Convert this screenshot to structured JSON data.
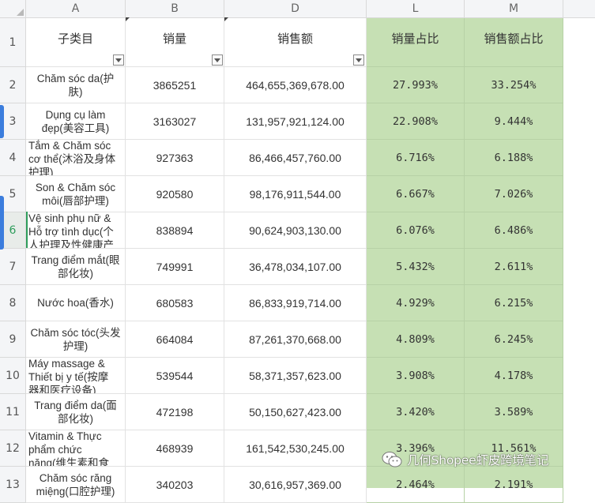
{
  "columns": [
    "A",
    "B",
    "D",
    "L",
    "M"
  ],
  "header_row": {
    "row_num": "1",
    "subcategory": "子类目",
    "sales_volume": "销量",
    "sales_amount": "销售额",
    "volume_share": "销量占比",
    "amount_share": "销售额占比"
  },
  "rows": [
    {
      "row_num": "2",
      "name": [
        "Chăm sóc da(护",
        "肤)"
      ],
      "volume": "3865251",
      "amount": "464,655,369,678.00",
      "volume_pct": "27.993%",
      "amount_pct": "33.254%"
    },
    {
      "row_num": "3",
      "name": [
        "Dụng cụ làm",
        "đẹp(美容工具)"
      ],
      "volume": "3163027",
      "amount": "131,957,921,124.00",
      "volume_pct": "22.908%",
      "amount_pct": "9.444%"
    },
    {
      "row_num": "4",
      "name": [
        "Tắm & Chăm sóc",
        "cơ thể(沐浴及身体",
        "护理)"
      ],
      "volume": "927363",
      "amount": "86,466,457,760.00",
      "volume_pct": "6.716%",
      "amount_pct": "6.188%"
    },
    {
      "row_num": "5",
      "name": [
        "Son & Chăm sóc",
        "môi(唇部护理)"
      ],
      "volume": "920580",
      "amount": "98,176,911,544.00",
      "volume_pct": "6.667%",
      "amount_pct": "7.026%"
    },
    {
      "row_num": "6",
      "name": [
        "Vệ sinh phụ nữ &",
        "Hỗ trợ tình dục(个",
        "人护理及性健康产"
      ],
      "volume": "838894",
      "amount": "90,624,903,130.00",
      "volume_pct": "6.076%",
      "amount_pct": "6.486%"
    },
    {
      "row_num": "7",
      "name": [
        "Trang điểm mắt(眼",
        "部化妆)"
      ],
      "volume": "749991",
      "amount": "36,478,034,107.00",
      "volume_pct": "5.432%",
      "amount_pct": "2.611%"
    },
    {
      "row_num": "8",
      "name": [
        "Nước hoa(香水)"
      ],
      "volume": "680583",
      "amount": "86,833,919,714.00",
      "volume_pct": "4.929%",
      "amount_pct": "6.215%"
    },
    {
      "row_num": "9",
      "name": [
        "Chăm sóc tóc(头发",
        "护理)"
      ],
      "volume": "664084",
      "amount": "87,261,370,668.00",
      "volume_pct": "4.809%",
      "amount_pct": "6.245%"
    },
    {
      "row_num": "10",
      "name": [
        "Máy massage &",
        "Thiết bị y tế(按摩",
        "器和医疗设备)"
      ],
      "volume": "539544",
      "amount": "58,371,357,623.00",
      "volume_pct": "3.908%",
      "amount_pct": "4.178%"
    },
    {
      "row_num": "11",
      "name": [
        "Trang điểm da(面",
        "部化妆)"
      ],
      "volume": "472198",
      "amount": "50,150,627,423.00",
      "volume_pct": "3.420%",
      "amount_pct": "3.589%"
    },
    {
      "row_num": "12",
      "name": [
        "Vitamin & Thực",
        "phẩm chức",
        "năng(维生素和食"
      ],
      "volume": "468939",
      "amount": "161,542,530,245.00",
      "volume_pct": "3.396%",
      "amount_pct": "11.561%"
    },
    {
      "row_num": "13",
      "name": [
        "Chăm sóc răng",
        "miệng(口腔护理)"
      ],
      "volume": "340203",
      "amount": "30,616,957,369.00",
      "volume_pct": "2.464%",
      "amount_pct": "2.191%"
    }
  ],
  "watermark": {
    "text": "几何Shopee虾皮跨境笔记",
    "icon": "wechat-icon"
  },
  "colors": {
    "highlight_fill": "#c6e0b4",
    "active_row_accent": "#2e9d5b",
    "side_tab": "#3b7ddd"
  }
}
